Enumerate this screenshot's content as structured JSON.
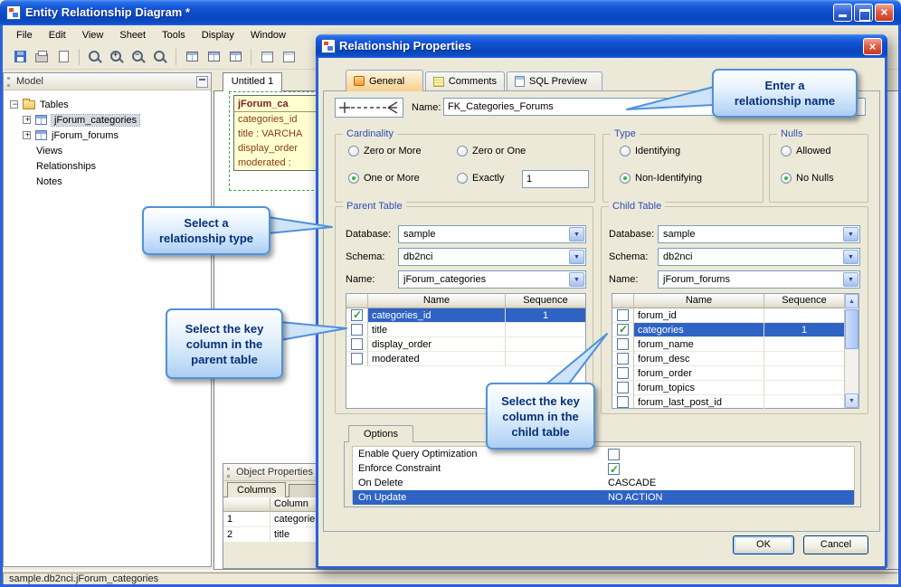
{
  "window": {
    "title": "Entity Relationship Diagram *",
    "menus": [
      "File",
      "Edit",
      "View",
      "Sheet",
      "Tools",
      "Display",
      "Window"
    ],
    "status": "sample.db2nci.jForum_categories"
  },
  "toolbar_icons": [
    "save",
    "print",
    "print-preview",
    "zoom",
    "zoom-in",
    "zoom-out",
    "zoom-fit",
    "show-grid",
    "align-grid",
    "snap-grid",
    "new-sheet",
    "sheet-properties"
  ],
  "model_panel": {
    "title": "Model",
    "items": [
      "Tables",
      "jForum_categories",
      "jForum_forums",
      "Views",
      "Relationships",
      "Notes"
    ]
  },
  "canvas": {
    "tab": "Untitled 1",
    "erd_table": {
      "title": "jForum_ca",
      "fields": [
        "categories_id",
        "title : VARCHA",
        "display_order",
        "moderated : "
      ]
    }
  },
  "object_properties": {
    "title": "Object Properties",
    "tab": "Columns",
    "column_header": "Column",
    "rows": [
      {
        "num": "1",
        "name": "categorie"
      },
      {
        "num": "2",
        "name": "title"
      }
    ]
  },
  "dialog": {
    "title": "Relationship Properties",
    "tabs": [
      "General",
      "Comments",
      "SQL Preview"
    ],
    "name_label": "Name:",
    "name_value": "FK_Categories_Forums",
    "cardinality": {
      "title": "Cardinality",
      "zero_or_more": "Zero or More",
      "zero_or_one": "Zero or One",
      "one_or_more": "One or More",
      "exactly": "Exactly",
      "exactly_value": "1",
      "selected": "One or More"
    },
    "type": {
      "title": "Type",
      "identifying": "Identifying",
      "non_identifying": "Non-Identifying",
      "selected": "Non-Identifying"
    },
    "nulls": {
      "title": "Nulls",
      "allowed": "Allowed",
      "no_nulls": "No Nulls",
      "selected": "No Nulls"
    },
    "parent": {
      "title": "Parent Table",
      "database_label": "Database:",
      "database": "sample",
      "schema_label": "Schema:",
      "schema": "db2nci",
      "name_label": "Name:",
      "name": "jForum_categories",
      "grid": {
        "name_header": "Name",
        "sequence_header": "Sequence",
        "rows": [
          {
            "name": "categories_id",
            "seq": "1",
            "checked": true,
            "selected": true
          },
          {
            "name": "title",
            "seq": "",
            "checked": false,
            "selected": false
          },
          {
            "name": "display_order",
            "seq": "",
            "checked": false,
            "selected": false
          },
          {
            "name": "moderated",
            "seq": "",
            "checked": false,
            "selected": false
          }
        ]
      }
    },
    "child": {
      "title": "Child Table",
      "database_label": "Database:",
      "database": "sample",
      "schema_label": "Schema:",
      "schema": "db2nci",
      "name_label": "Name:",
      "name": "jForum_forums",
      "grid": {
        "name_header": "Name",
        "sequence_header": "Sequence",
        "rows": [
          {
            "name": "forum_id",
            "seq": "",
            "checked": false,
            "selected": false
          },
          {
            "name": "categories",
            "seq": "1",
            "checked": true,
            "selected": true
          },
          {
            "name": "forum_name",
            "seq": "",
            "checked": false,
            "selected": false
          },
          {
            "name": "forum_desc",
            "seq": "",
            "checked": false,
            "selected": false
          },
          {
            "name": "forum_order",
            "seq": "",
            "checked": false,
            "selected": false
          },
          {
            "name": "forum_topics",
            "seq": "",
            "checked": false,
            "selected": false
          },
          {
            "name": "forum_last_post_id",
            "seq": "",
            "checked": false,
            "selected": false
          }
        ]
      }
    },
    "options": {
      "tab": "Options",
      "rows": [
        {
          "label": "Enable Query Optimization",
          "value": "",
          "checkbox": "unchecked"
        },
        {
          "label": "Enforce Constraint",
          "value": "",
          "checkbox": "checked"
        },
        {
          "label": "On Delete",
          "value": "CASCADE"
        },
        {
          "label": "On Update",
          "value": "NO ACTION",
          "selected": true
        }
      ]
    },
    "ok": "OK",
    "cancel": "Cancel"
  },
  "callouts": [
    {
      "lines": [
        "Enter a",
        "relationship name"
      ]
    },
    {
      "lines": [
        "Select a",
        "relationship type"
      ]
    },
    {
      "lines": [
        "Select the key",
        "column in the",
        "parent table"
      ]
    },
    {
      "lines": [
        "Select the key",
        "column in the",
        "child table"
      ]
    }
  ],
  "colors": {
    "selection": "#2e63c4",
    "titlebar_blue": "#1355d6",
    "callout_border": "#4e92da",
    "check_green": "#2aa02a"
  }
}
